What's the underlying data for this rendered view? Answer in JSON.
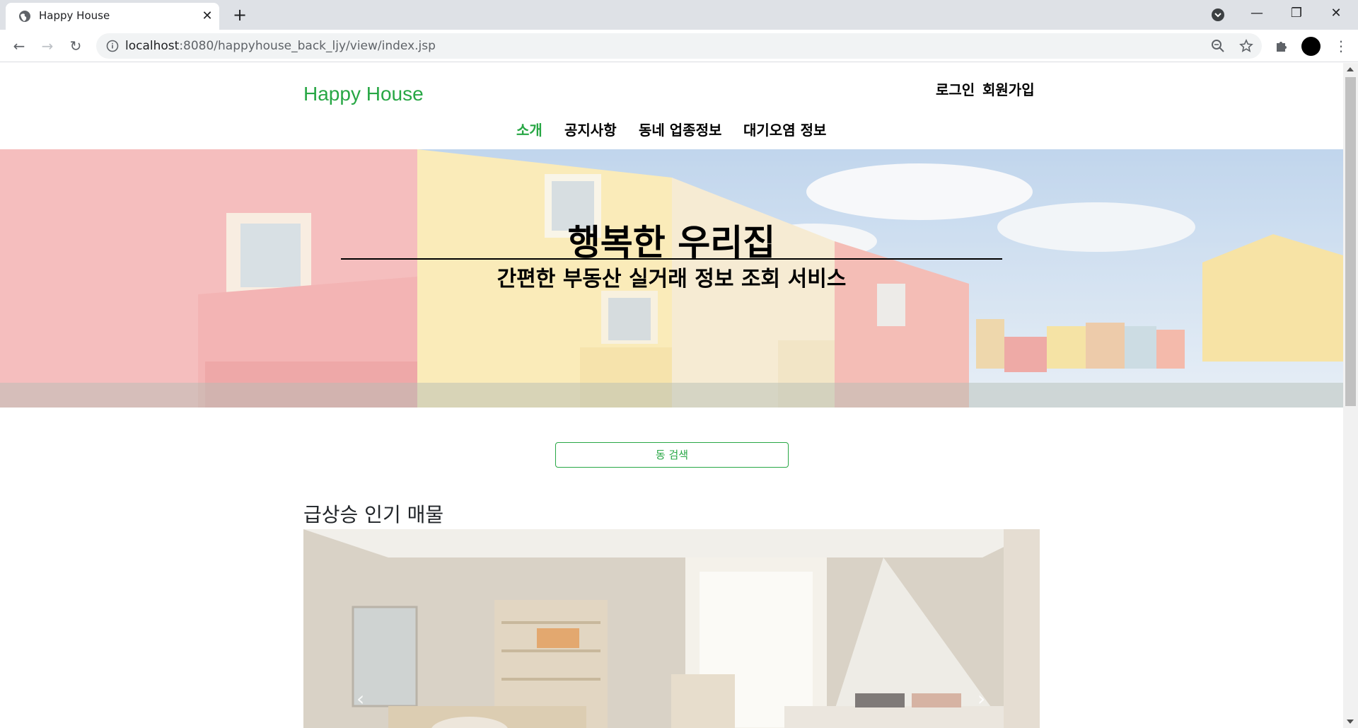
{
  "browser": {
    "tab_title": "Happy House",
    "url_host": "localhost",
    "url_rest": ":8080/happyhouse_back_ljy/view/index.jsp"
  },
  "header": {
    "brand": "Happy House",
    "login": "로그인",
    "signup": "회원가입",
    "menu": [
      {
        "label": "소개",
        "active": true
      },
      {
        "label": "공지사항",
        "active": false
      },
      {
        "label": "동네 업종정보",
        "active": false
      },
      {
        "label": "대기오염 정보",
        "active": false
      }
    ]
  },
  "hero": {
    "title": "행복한 우리집",
    "subtitle": "간편한 부동산 실거래 정보 조회 서비스"
  },
  "search": {
    "button_label": "동 검색"
  },
  "section": {
    "title": "급상승 인기 매물"
  },
  "colors": {
    "brand": "#28a745",
    "text": "#000000"
  },
  "icons": [
    "globe-icon",
    "close-icon",
    "plus-icon",
    "back-icon",
    "forward-icon",
    "reload-icon",
    "info-icon",
    "zoom-icon",
    "star-icon",
    "puzzle-icon",
    "menu-icon",
    "chevron-left-icon",
    "chevron-right-icon"
  ]
}
